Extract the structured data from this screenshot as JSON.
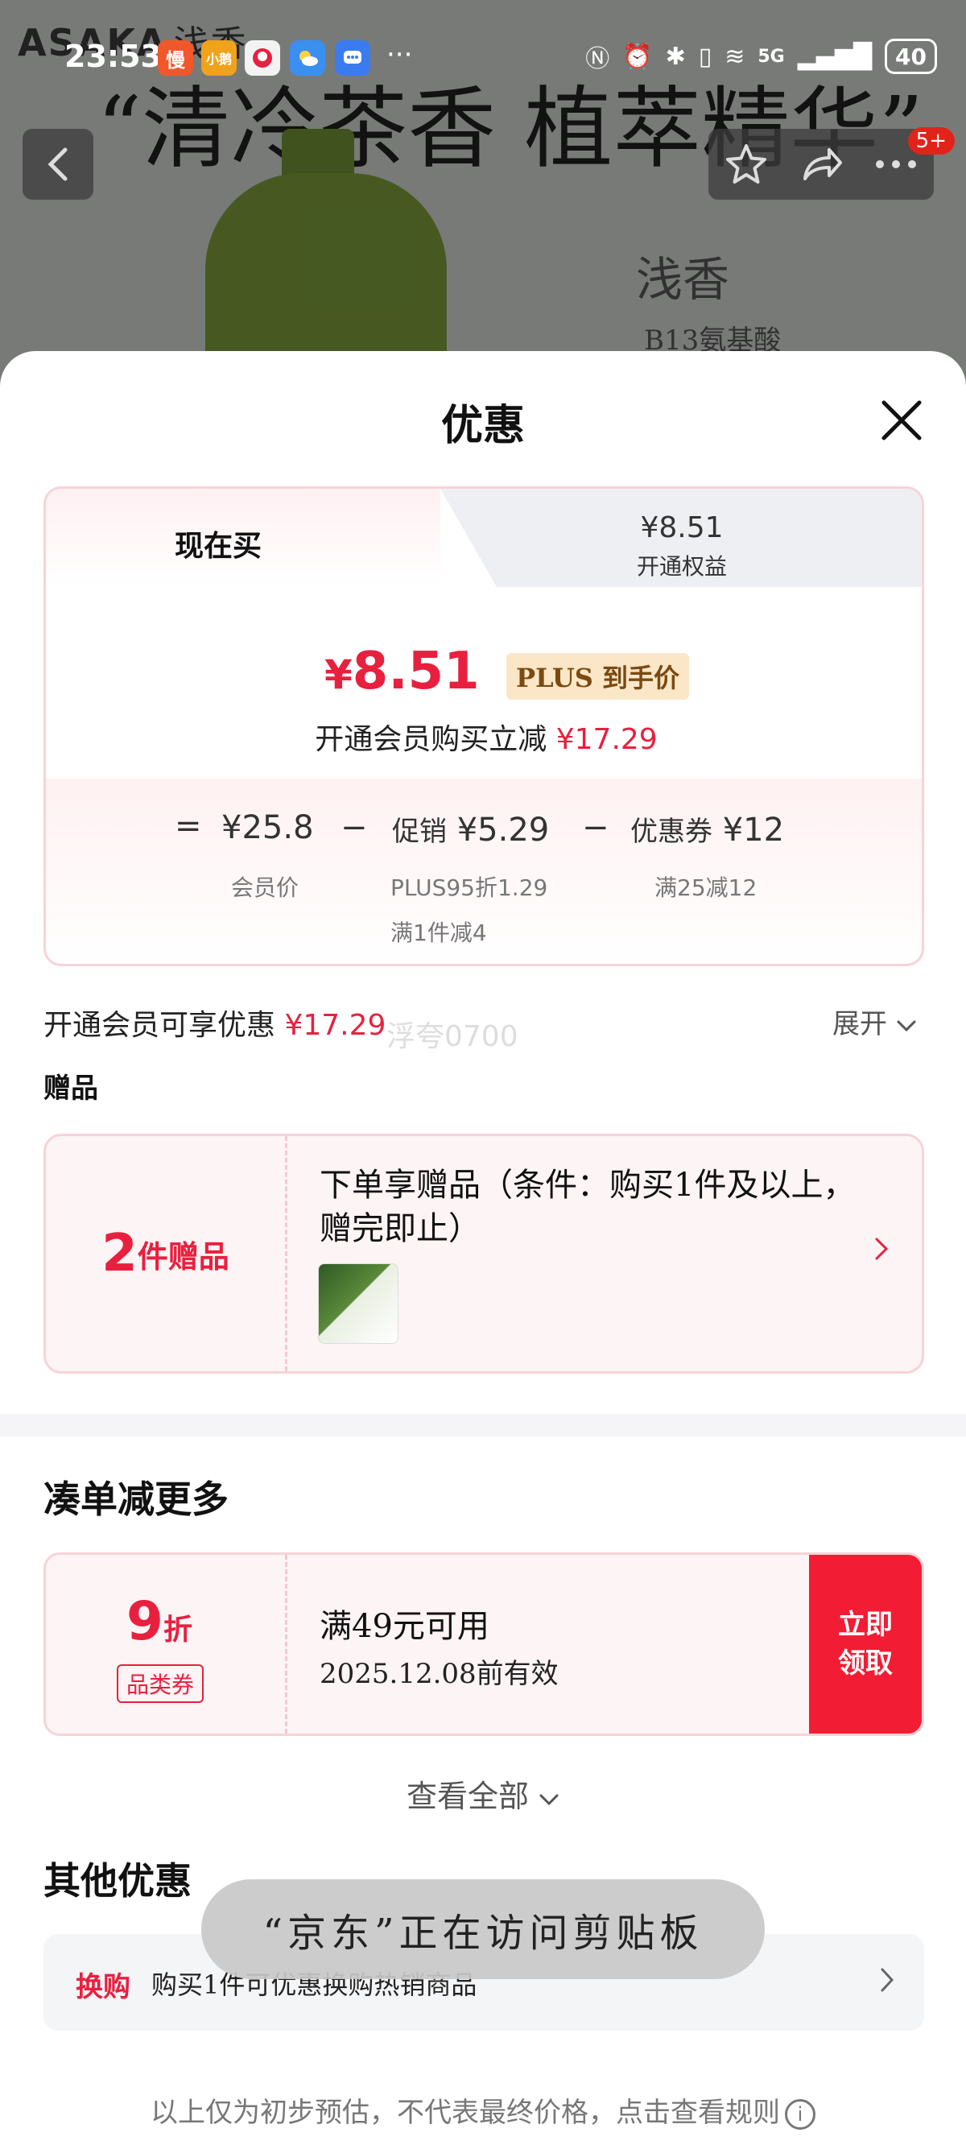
{
  "status_bar": {
    "time": "23:53",
    "apps": [
      "慢",
      "小鹅",
      "",
      "",
      ""
    ],
    "more": "···",
    "network": "5G",
    "battery": "40"
  },
  "background": {
    "brand": "ASAKA",
    "brand_cn": "浅香",
    "slogan": "“清冷茶香 植萃精华”",
    "badge_title": "浅香",
    "badge_sub": "B13氨基酸",
    "notification_count": "5+"
  },
  "sheet": {
    "title": "优惠",
    "tabs": {
      "left_label": "现在买",
      "right_price": "¥8.51",
      "right_label": "开通权益"
    },
    "price": {
      "currency": "¥",
      "amount": "8.51",
      "tag": "PLUS 到手价",
      "save_text": "开通会员购买立减",
      "save_amount": "¥17.29"
    },
    "calculation": {
      "equals": "=",
      "member_price": "¥25.8",
      "member_price_label": "会员价",
      "minus1": "−",
      "promo_label": "促销",
      "promo_amount": "¥5.29",
      "promo_detail_1": "PLUS95折1.29",
      "promo_detail_2": "满1件减4",
      "minus2": "−",
      "coupon_label": "优惠券",
      "coupon_amount": "¥12",
      "coupon_detail": "满25减12"
    },
    "member_benefit": {
      "text": "开通会员可享优惠",
      "amount": "¥17.29",
      "expand_label": "展开"
    },
    "watermark": "浮夸0700",
    "gift_section": {
      "title": "赠品",
      "count": "2",
      "unit": "件赠品",
      "description": "下单享赠品（条件：购买1件及以上，赠完即止）"
    },
    "bundle_section": {
      "title": "凑单减更多",
      "coupon_discount": "9",
      "coupon_unit": "折",
      "coupon_category": "品类券",
      "coupon_condition": "满49元可用",
      "coupon_expiry": "2025.12.08前有效",
      "coupon_button": "立即领取",
      "view_all": "查看全部"
    },
    "other_section": {
      "title": "其他优惠",
      "tag": "换购",
      "text": "购买1件可优惠换购热销商品"
    },
    "toast": "“京东”正在访问剪贴板",
    "footer_note": "以上仅为初步预估，不代表最终价格，点击查看规则",
    "info_icon": "i"
  },
  "colors": {
    "accent_red": "#e8203f",
    "button_red": "#f21d35",
    "plus_gold_bg": "#fbe7c7",
    "plus_gold_text": "#7a4a12",
    "card_border": "#f6d3d7"
  }
}
